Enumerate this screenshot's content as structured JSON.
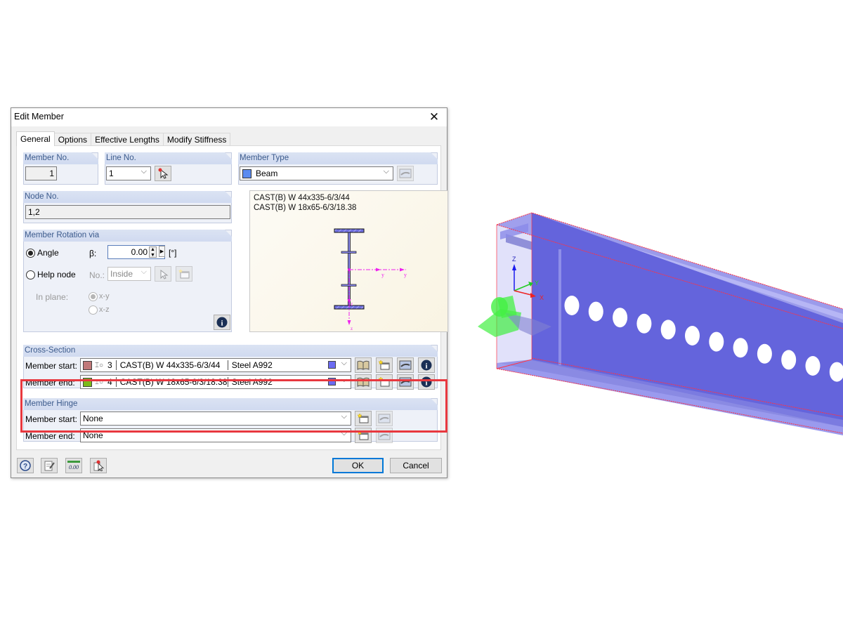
{
  "dialog": {
    "title": "Edit Member",
    "close_icon": "close-icon",
    "tabs": [
      {
        "label": "General",
        "active": true
      },
      {
        "label": "Options",
        "active": false
      },
      {
        "label": "Effective Lengths",
        "active": false
      },
      {
        "label": "Modify Stiffness",
        "active": false
      }
    ],
    "member_no": {
      "header": "Member No.",
      "value": "1"
    },
    "line_no": {
      "header": "Line No.",
      "value": "1",
      "pick_icon": "pick-cursor-icon"
    },
    "member_type": {
      "header": "Member Type",
      "value": "Beam",
      "color": "#5b8bf0",
      "edit_icon": "edit-hand-icon"
    },
    "node_no": {
      "header": "Node No.",
      "value": "1,2"
    },
    "rotation": {
      "header": "Member Rotation via",
      "angle_label": "Angle",
      "angle_selected": true,
      "beta_label": "β:",
      "beta_value": "0.00",
      "beta_unit": "[°]",
      "help_node_label": "Help node",
      "no_label": "No.:",
      "no_value": "Inside",
      "in_plane_label": "In plane:",
      "plane_options": [
        {
          "label": "x-y",
          "selected": true
        },
        {
          "label": "x-z",
          "selected": false
        }
      ],
      "info_icon": "info-icon"
    },
    "preview": {
      "lines": [
        "CAST(B) W 44x335-6/3/44",
        "CAST(B) W 18x65-6/3/18.38"
      ],
      "axis_y_label": "y",
      "axis_z_label": "z"
    },
    "cross_section": {
      "header": "Cross-Section",
      "rows": [
        {
          "label": "Member start:",
          "color": "#c07878",
          "number": "3",
          "name": "CAST(B) W 44x335-6/3/44",
          "material": "Steel A992",
          "material_color": "#6b6bf2"
        },
        {
          "label": "Member end:",
          "color": "#7cba1a",
          "number": "4",
          "name": "CAST(B) W 18x65-6/3/18.38",
          "material": "Steel A992",
          "material_color": "#6b6bf2"
        }
      ],
      "buttons": [
        "library-book-icon",
        "new-section-icon",
        "edit-hand-icon",
        "info-icon"
      ]
    },
    "hinge": {
      "header": "Member Hinge",
      "rows": [
        {
          "label": "Member start:",
          "value": "None"
        },
        {
          "label": "Member end:",
          "value": "None"
        }
      ]
    },
    "footer": {
      "icons": [
        "help-icon",
        "notes-icon",
        "units-icon",
        "pick-icon"
      ],
      "units_text": "0.00",
      "ok_label": "OK",
      "cancel_label": "Cancel"
    }
  },
  "viewport": {
    "axis_labels": {
      "x": "X",
      "y": "Y",
      "z": "Z"
    },
    "beam_color": "#6666dd",
    "highlight_color": "#e8383f"
  }
}
